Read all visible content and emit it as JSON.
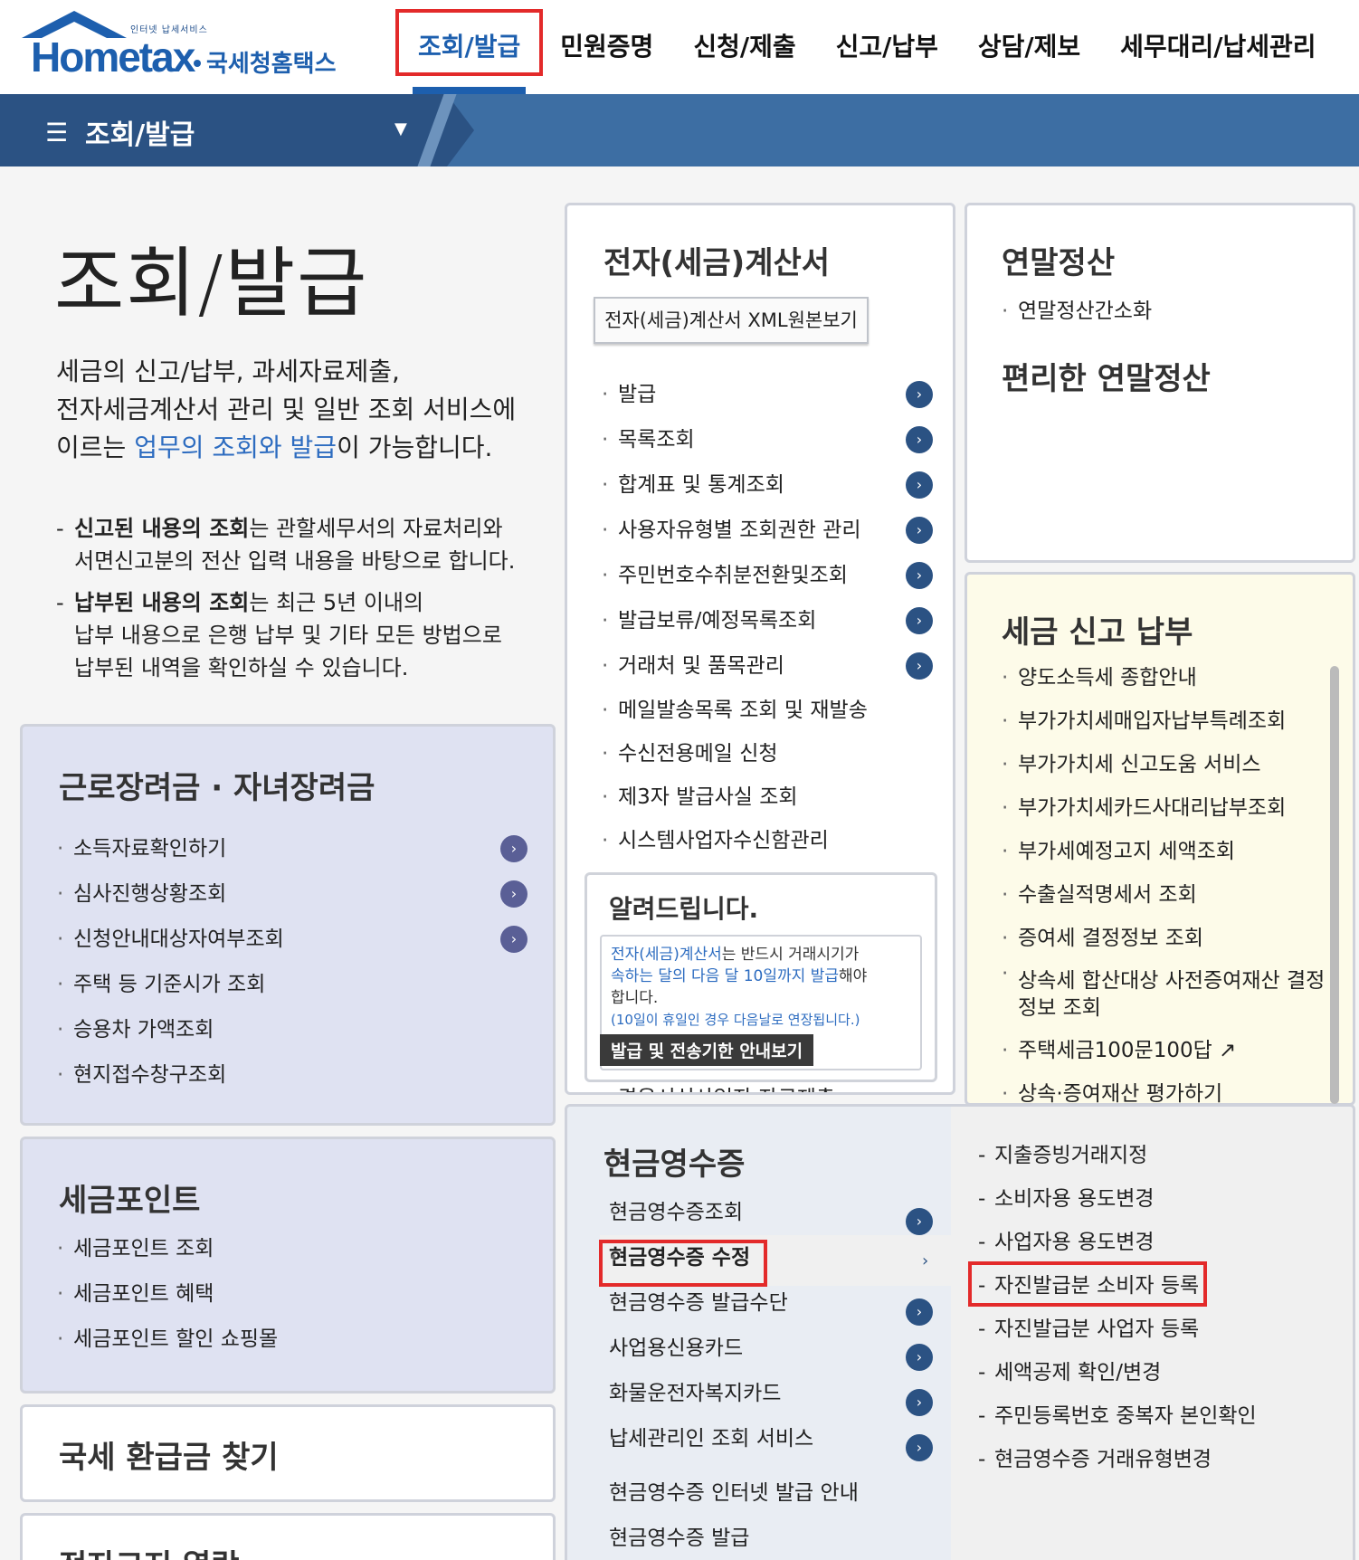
{
  "logo": {
    "tiny": "인터넷 납세서비스",
    "brand": "Hometax",
    "korean": "국세청홈택스"
  },
  "gnb": [
    "조회/발급",
    "민원증명",
    "신청/제출",
    "신고/납부",
    "상담/제보",
    "세무대리/납세관리"
  ],
  "subbar": {
    "title": "조회/발급"
  },
  "page": {
    "title": "조회/발급",
    "desc1": "세금의 신고/납부, 과세자료제출,",
    "desc2": "전자세금계산서 관리 및 일반 조회 서비스에",
    "desc3a": "이르는 ",
    "desc3b": "업무의 조회와 발급",
    "desc3c": "이 가능합니다.",
    "note1_bold": "신고된 내용의 조회",
    "note1_rest": "는 관할세무서의 자료처리와",
    "note1_line2": "서면신고분의 전산 입력 내용을 바탕으로 합니다.",
    "note2_bold": "납부된 내용의 조회",
    "note2_rest": "는 최근 5년 이내의",
    "note2_line2": "납부 내용으로 은행 납부 및 기타 모든 방법으로",
    "note2_line3": "납부된 내역을 확인하실 수 있습니다."
  },
  "earned_income": {
    "title": "근로장려금 · 자녀장려금",
    "items": [
      "소득자료확인하기",
      "심사진행상황조회",
      "신청안내대상자여부조회",
      "주택 등 기준시가 조회",
      "승용차 가액조회",
      "현지접수창구조회"
    ]
  },
  "tax_point": {
    "title": "세금포인트",
    "items": [
      "세금포인트 조회",
      "세금포인트 혜택",
      "세금포인트 할인 쇼핑몰"
    ]
  },
  "refund": {
    "title": "국세 환급금 찾기"
  },
  "einvoice_partial": {
    "title": "전자고지 열람"
  },
  "einvoice": {
    "title": "전자(세금)계산서",
    "xml_button": "전자(세금)계산서 XML원본보기",
    "items": [
      "발급",
      "목록조회",
      "합계표 및 통계조회",
      "사용자유형별 조회권한 관리",
      "주민번호수취분전환및조회",
      "발급보류/예정목록조회",
      "거래처 및 품목관리",
      "메일발송목록 조회 및 재발송",
      "수신전용메일 신청",
      "제3자 발급사실 조회",
      "시스템사업자수신함관리"
    ],
    "hidden_item": "경용서식사업자 자료제출"
  },
  "notice": {
    "title": "알려드립니다.",
    "line1a": "전자(세금)계산서",
    "line1b": "는 반드시 거래시기가",
    "line2": "속하는 달의 다음 달 10일까지 발급",
    "line2b": "해야",
    "line3": "합니다.",
    "line4": "(10일이 휴일인 경우 다음날로 연장됩니다.)",
    "button": "발급 및 전송기한 안내보기"
  },
  "year_end": {
    "title": "연말정산",
    "items": [
      "연말정산간소화"
    ],
    "sub_title": "편리한 연말정산"
  },
  "tax_filing": {
    "title": "세금 신고 납부",
    "items": [
      "양도소득세 종합안내",
      "부가가치세매입자납부특례조회",
      "부가가치세 신고도움 서비스",
      "부가가치세카드사대리납부조회",
      "부가세예정고지 세액조회",
      "수출실적명세서 조회",
      "증여세 결정정보 조회",
      "상속세 합산대상 사전증여재산 결정",
      "주택세금100문100답",
      "상속·증여재산 평가하기"
    ],
    "item_wrap": "정보 조회"
  },
  "cash_receipt": {
    "title": "현금영수증",
    "items": [
      "현금영수증조회",
      "현금영수증 수정",
      "현금영수증 발급수단",
      "사업용신용카드",
      "화물운전자복지카드",
      "납세관리인 조회 서비스",
      "현금영수증 인터넷 발급 안내",
      "현금영수증 발급"
    ],
    "submenu": [
      "지출증빙거래지정",
      "소비자용 용도변경",
      "사업자용 용도변경",
      "자진발급분 소비자 등록",
      "자진발급분 사업자 등록",
      "세액공제 확인/변경",
      "주민등록번호 중복자 본인확인",
      "현금영수증 거래유형변경"
    ]
  }
}
